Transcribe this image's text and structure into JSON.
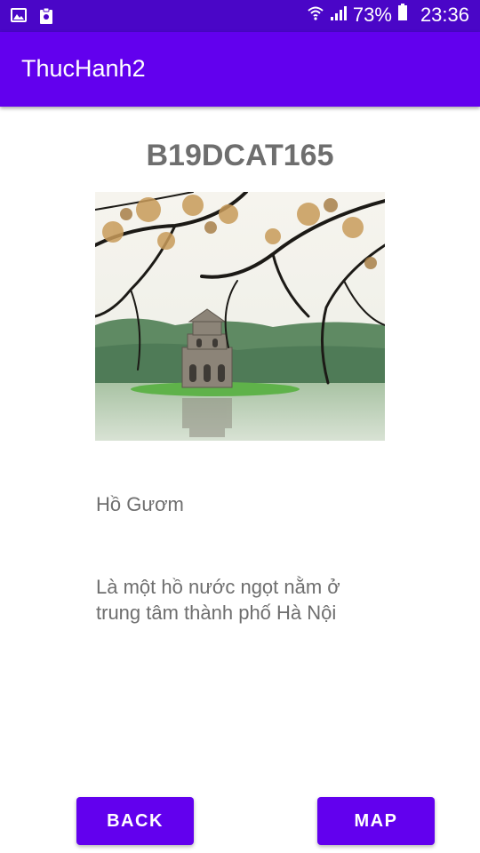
{
  "status_bar": {
    "battery": "73%",
    "time": "23:36",
    "icons": [
      "image-icon",
      "clipboard-icon",
      "wifi-icon",
      "signal-icon",
      "battery-icon"
    ]
  },
  "app_bar": {
    "title": "ThucHanh2"
  },
  "content": {
    "student_code": "B19DCAT165",
    "place_name": "Hồ Gươm",
    "place_description": "Là một hồ nước ngọt nằm ở trung tâm thành phố Hà Nội"
  },
  "buttons": {
    "back_label": "BACK",
    "map_label": "MAP"
  },
  "colors": {
    "status_bar": "#4a06c7",
    "primary": "#6200ee",
    "text_gray": "#6e6e6e"
  }
}
